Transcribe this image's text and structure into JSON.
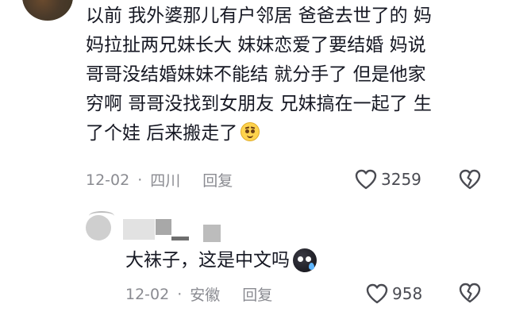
{
  "comment": {
    "text": "以前 我外婆那儿有户邻居 爸爸去世了的 妈\n妈拉扯两兄妹长大 妹妹恋爱了要结婚 妈说\n哥哥没结婚妹妹不能结 就分手了 但是他家\n穷啊 哥哥没找到女朋友 兄妹搞在一起了 生\n了个娃 后来搬走了",
    "emoji": "smirk-emoji",
    "date": "12-02",
    "separator": "·",
    "location": "四川",
    "reply_label": "回复",
    "like_count": "3259"
  },
  "reply": {
    "text": "大袜子，这是中文吗",
    "emoji": "crying-ball-emoji",
    "date": "12-02",
    "separator": "·",
    "location": "安徽",
    "reply_label": "回复",
    "like_count": "958"
  },
  "icons": {
    "like": "heart-outline-icon",
    "dislike": "broken-heart-icon"
  },
  "colors": {
    "text": "#161823",
    "meta": "#8a8b91"
  }
}
